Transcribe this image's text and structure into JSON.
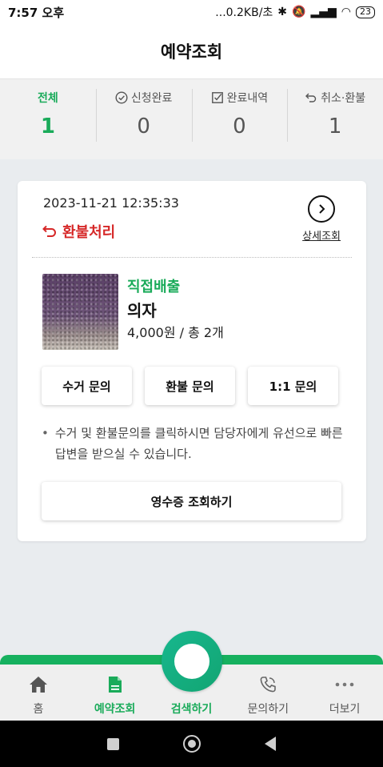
{
  "status_bar": {
    "time": "7:57 오후",
    "network_speed": "...0.2KB/초",
    "battery": "23"
  },
  "header": {
    "title": "예약조회"
  },
  "summary_tabs": [
    {
      "label": "전체",
      "count": "1",
      "icon": "none"
    },
    {
      "label": "신청완료",
      "count": "0",
      "icon": "check-circle-icon"
    },
    {
      "label": "완료내역",
      "count": "0",
      "icon": "checkbox-icon"
    },
    {
      "label": "취소·환불",
      "count": "1",
      "icon": "undo-icon"
    }
  ],
  "order": {
    "datetime": "2023-11-21 12:35:33",
    "status": "환불처리",
    "detail_label": "상세조회",
    "category": "직접배출",
    "item_name": "의자",
    "price": "4,000",
    "price_unit": "원",
    "quantity_text": " / 총 2개",
    "buttons": [
      "수거 문의",
      "환불 문의",
      "1:1 문의"
    ],
    "note": "수거 및 환불문의를 클릭하시면 담당자에게 유선으로 빠른 답변을 받으실 수 있습니다.",
    "receipt_label": "영수증 조회하기"
  },
  "bottom_nav": [
    {
      "label": "홈",
      "icon": "home-icon"
    },
    {
      "label": "예약조회",
      "icon": "document-icon"
    },
    {
      "label": "검색하기",
      "icon": "search-circle"
    },
    {
      "label": "문의하기",
      "icon": "phone-icon"
    },
    {
      "label": "더보기",
      "icon": "more-icon"
    }
  ],
  "colors": {
    "accent_green": "#1aab5a",
    "refund_red": "#d62828",
    "nav_green": "#16b15f"
  }
}
